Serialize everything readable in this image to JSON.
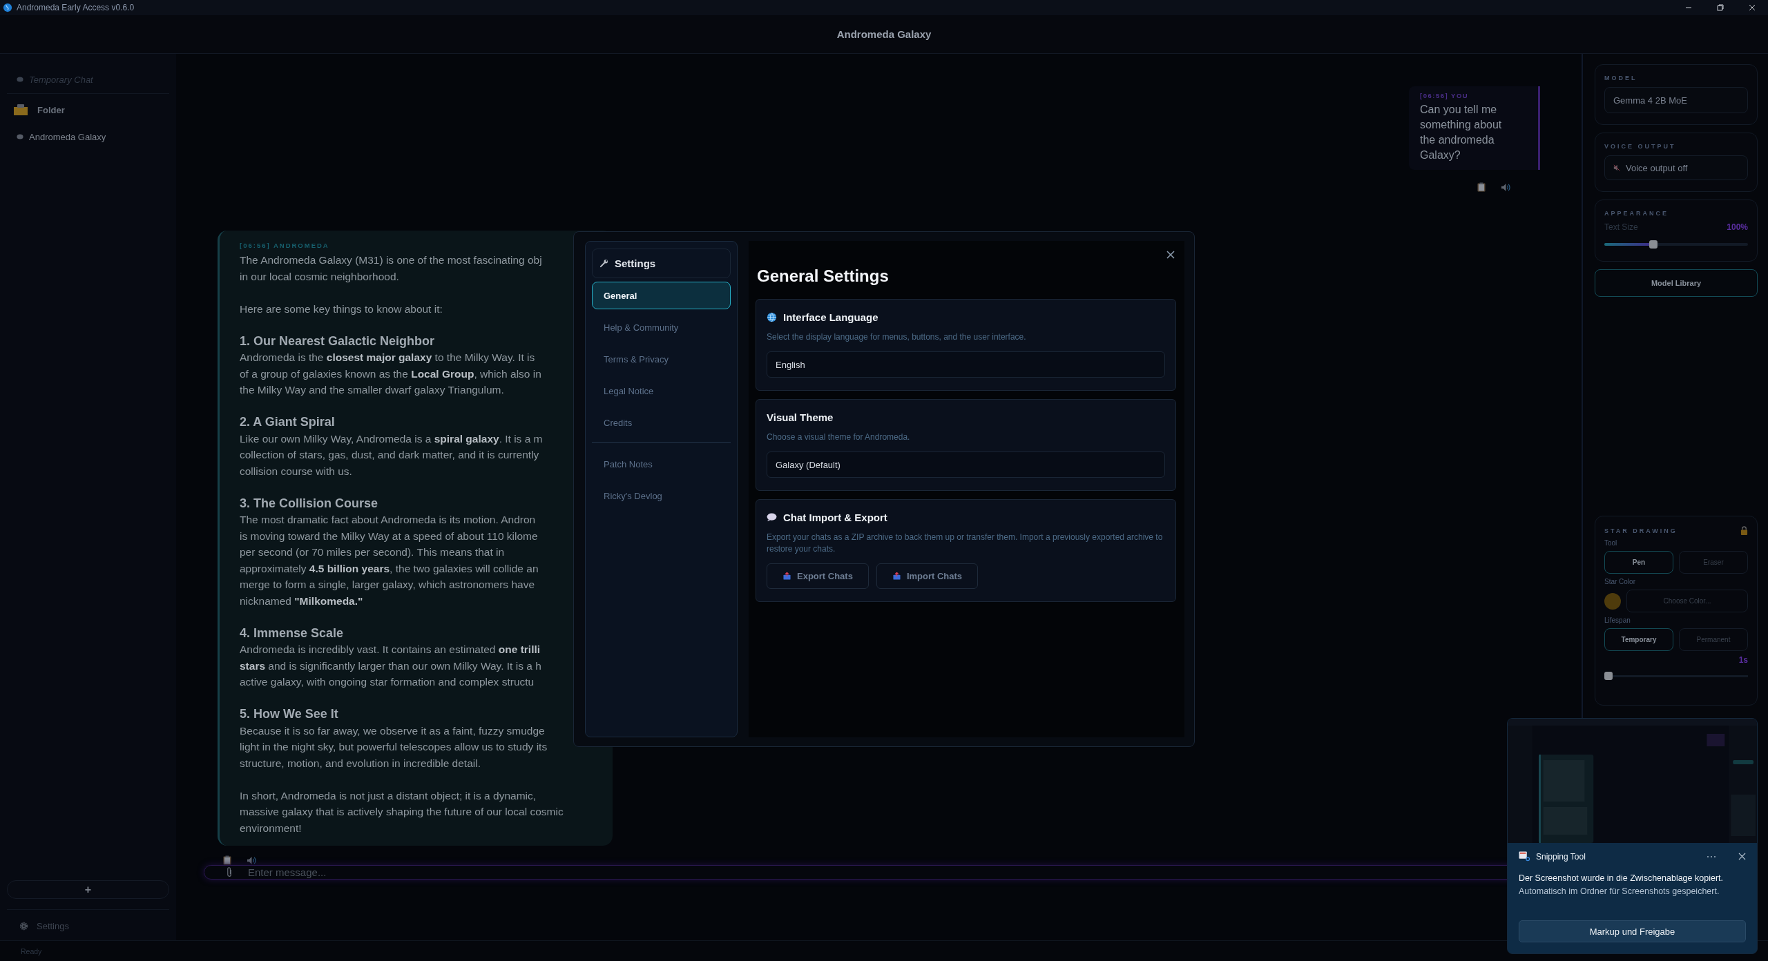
{
  "window": {
    "title": "Andromeda Early Access v0.6.0"
  },
  "header": {
    "title": "Andromeda Galaxy"
  },
  "sidebar": {
    "items": [
      {
        "kind": "temporary",
        "label": "Temporary Chat"
      },
      {
        "kind": "folder",
        "label": "Folder",
        "children": [
          {
            "kind": "chat",
            "label": "Andromeda Galaxy"
          }
        ]
      }
    ],
    "new_chat_button": "+",
    "settings": "Settings"
  },
  "messages": [
    {
      "kind": "user",
      "label": "[06:56] YOU",
      "text": "Can you tell me something about the andromeda Galaxy?"
    },
    {
      "kind": "assistant",
      "label": "[06:56] ANDROMEDA",
      "blocks": [
        {
          "kind": "paragraph",
          "lines": [
            "The Andromeda Galaxy (M31) is one of the most fascinating obj",
            "in our local cosmic neighborhood."
          ]
        },
        {
          "kind": "paragraph",
          "lines": [
            "Here are some key things to know about it:"
          ]
        },
        {
          "kind": "heading",
          "text": "1. Our Nearest Galactic Neighbor"
        },
        {
          "kind": "paragraph",
          "lines": [
            "Andromeda is the **closest major galaxy** to the Milky Way. It is",
            "of a group of galaxies known as the **Local Group**, which also in",
            "the Milky Way and the smaller dwarf galaxy Triangulum."
          ]
        },
        {
          "kind": "heading",
          "text": "2. A Giant Spiral"
        },
        {
          "kind": "paragraph",
          "lines": [
            "Like our own Milky Way, Andromeda is a **spiral galaxy**. It is a m",
            "collection of stars, gas, dust, and dark matter, and it is currently",
            "collision course with us."
          ]
        },
        {
          "kind": "heading",
          "text": "3. The Collision Course"
        },
        {
          "kind": "paragraph",
          "lines": [
            "The most dramatic fact about Andromeda is its motion. Andron",
            "is moving toward the Milky Way at a speed of about 110 kilome",
            "per second (or 70 miles per second). This means that in",
            "approximately **4.5 billion years**, the two galaxies will collide an",
            "merge to form a single, larger galaxy, which astronomers have",
            "nicknamed **\"Milkomeda.\"**"
          ]
        },
        {
          "kind": "heading",
          "text": "4. Immense Scale"
        },
        {
          "kind": "paragraph",
          "lines": [
            "Andromeda is incredibly vast. It contains an estimated **one trilli**",
            "**stars** and is significantly larger than our own Milky Way. It is a h",
            "active galaxy, with ongoing star formation and complex structu"
          ]
        },
        {
          "kind": "heading",
          "text": "5. How We See It"
        },
        {
          "kind": "paragraph",
          "lines": [
            "Because it is so far away, we observe it as a faint, fuzzy smudge",
            "light in the night sky, but powerful telescopes allow us to study its",
            "structure, motion, and evolution in incredible detail."
          ]
        },
        {
          "kind": "paragraph",
          "lines": [
            "In short, Andromeda is not just a distant object; it is a dynamic,",
            "massive galaxy that is actively shaping the future of our local cosmic",
            "environment!"
          ]
        }
      ]
    }
  ],
  "composer": {
    "placeholder": "Enter message..."
  },
  "status_bar": {
    "text": "Ready"
  },
  "right_panel": {
    "model": {
      "label": "MODEL",
      "value": "Gemma 4 2B MoE"
    },
    "voice": {
      "label": "VOICE OUTPUT",
      "button": "Voice output off"
    },
    "appearance": {
      "label": "APPEARANCE",
      "setting": "Text Size",
      "reading": "100%",
      "level": 0.34
    },
    "model_library": "Model Library",
    "star_drawing": {
      "title": "STAR DRAWING",
      "tool_label": "Tool",
      "tools": [
        {
          "label": "Pen",
          "selected": true
        },
        {
          "label": "Eraser",
          "selected": false
        }
      ],
      "color_label": "Star Color",
      "color_button": "Choose Color...",
      "lifespan_label": "Lifespan",
      "lifespans": [
        {
          "label": "Temporary",
          "selected": true
        },
        {
          "label": "Permanent",
          "selected": false
        }
      ],
      "lifespan_slider": {
        "reading": "1s",
        "level": 0
      }
    }
  },
  "settings_modal": {
    "title": "Settings",
    "nav_groups": [
      [
        {
          "label": "General",
          "selected": true
        },
        {
          "label": "Help & Community",
          "selected": false
        },
        {
          "label": "Terms & Privacy",
          "selected": false
        },
        {
          "label": "Legal Notice",
          "selected": false
        },
        {
          "label": "Credits",
          "selected": false
        }
      ],
      [
        {
          "label": "Patch Notes",
          "selected": false
        },
        {
          "label": "Ricky's Devlog",
          "selected": false
        }
      ]
    ],
    "page_title": "General Settings",
    "sections": [
      {
        "kind": "language",
        "title": "Interface Language",
        "description": "Select the display language for menus, buttons, and the user interface.",
        "value": "English"
      },
      {
        "kind": "theme",
        "title": "Visual Theme",
        "description": "Choose a visual theme for Andromeda.",
        "value": "Galaxy (Default)"
      },
      {
        "kind": "transfer",
        "title": "Chat Import & Export",
        "description": "Export your chats as a ZIP archive to back them up or transfer them. Import a previously exported archive to restore your chats.",
        "buttons": [
          "Export Chats",
          "Import Chats"
        ]
      }
    ]
  },
  "notification": {
    "app": "Snipping Tool",
    "message": "Der Screenshot wurde in die Zwischenablage kopiert.",
    "detail": "Automatisch im Ordner für Screenshots gespeichert.",
    "button": "Markup und Freigabe"
  }
}
